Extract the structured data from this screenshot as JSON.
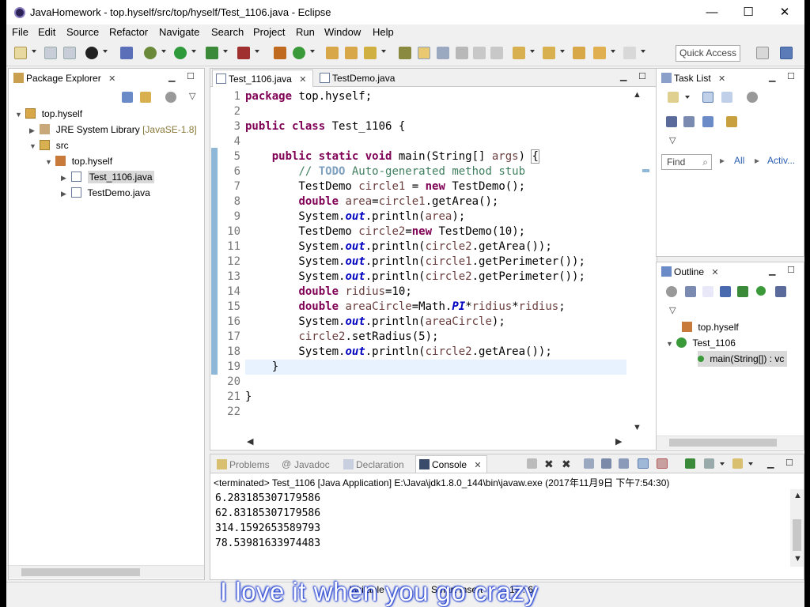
{
  "window": {
    "title": "JavaHomework - top.hyself/src/top/hyself/Test_1106.java - Eclipse",
    "minimize": "—",
    "maximize": "☐",
    "close": "✕"
  },
  "menu": [
    "File",
    "Edit",
    "Source",
    "Refactor",
    "Navigate",
    "Search",
    "Project",
    "Run",
    "Window",
    "Help"
  ],
  "toolbar": {
    "quick_access": "Quick Access"
  },
  "package_explorer": {
    "title": "Package Explorer",
    "tree": [
      {
        "label": "top.hyself",
        "level": 0,
        "expanded": true
      },
      {
        "label": "JRE System Library",
        "suffix": "[JavaSE-1.8]",
        "level": 1,
        "expanded": false
      },
      {
        "label": "src",
        "level": 1,
        "expanded": true
      },
      {
        "label": "top.hyself",
        "level": 2,
        "expanded": true
      },
      {
        "label": "Test_1106.java",
        "level": 3,
        "expanded": false,
        "selected": true
      },
      {
        "label": "TestDemo.java",
        "level": 3,
        "expanded": false
      }
    ]
  },
  "editor": {
    "tabs": [
      {
        "label": "Test_1106.java",
        "active": true
      },
      {
        "label": "TestDemo.java",
        "active": false
      }
    ],
    "line_numbers": [
      "1",
      "2",
      "3",
      "4",
      "5",
      "6",
      "7",
      "8",
      "9",
      "10",
      "11",
      "12",
      "13",
      "14",
      "15",
      "16",
      "17",
      "18",
      "19",
      "20",
      "21",
      "22"
    ]
  },
  "task_list": {
    "title": "Task List",
    "find_placeholder": "Find",
    "all_label": "All",
    "activate_label": "Activ..."
  },
  "outline": {
    "title": "Outline",
    "items": [
      {
        "label": "top.hyself"
      },
      {
        "label": "Test_1106"
      },
      {
        "label": "main(String[]) : vc"
      }
    ]
  },
  "bottom": {
    "tabs": [
      "Problems",
      "Javadoc",
      "Declaration",
      "Console"
    ],
    "active_tab": "Console",
    "terminated": "<terminated> Test_1106 [Java Application] E:\\Java\\jdk1.8.0_144\\bin\\javaw.exe (2017年11月9日 下午7:54:30)",
    "output": [
      "6.283185307179586",
      "62.83185307179586",
      "314.1592653589793",
      "78.53981633974483"
    ]
  },
  "status": {
    "writable": "Writable",
    "insert_mode": "Smart Insert",
    "position": "19 : 6"
  },
  "overlay": {
    "subtitle": "I love it when you go crazy"
  },
  "colors": {
    "keyword": "#7f0055",
    "comment": "#3f7f5f",
    "static_field": "#0000c0",
    "variable": "#6a3e3e",
    "current_line": "#e8f2fe"
  }
}
